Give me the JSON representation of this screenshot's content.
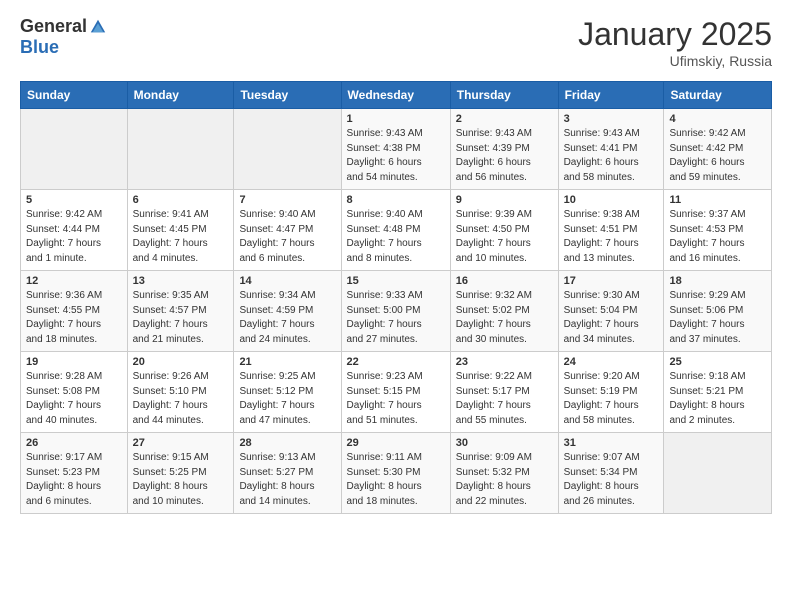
{
  "header": {
    "logo_general": "General",
    "logo_blue": "Blue",
    "month_title": "January 2025",
    "location": "Ufimskiy, Russia"
  },
  "weekdays": [
    "Sunday",
    "Monday",
    "Tuesday",
    "Wednesday",
    "Thursday",
    "Friday",
    "Saturday"
  ],
  "weeks": [
    [
      {
        "day": "",
        "info": ""
      },
      {
        "day": "",
        "info": ""
      },
      {
        "day": "",
        "info": ""
      },
      {
        "day": "1",
        "info": "Sunrise: 9:43 AM\nSunset: 4:38 PM\nDaylight: 6 hours\nand 54 minutes."
      },
      {
        "day": "2",
        "info": "Sunrise: 9:43 AM\nSunset: 4:39 PM\nDaylight: 6 hours\nand 56 minutes."
      },
      {
        "day": "3",
        "info": "Sunrise: 9:43 AM\nSunset: 4:41 PM\nDaylight: 6 hours\nand 58 minutes."
      },
      {
        "day": "4",
        "info": "Sunrise: 9:42 AM\nSunset: 4:42 PM\nDaylight: 6 hours\nand 59 minutes."
      }
    ],
    [
      {
        "day": "5",
        "info": "Sunrise: 9:42 AM\nSunset: 4:44 PM\nDaylight: 7 hours\nand 1 minute."
      },
      {
        "day": "6",
        "info": "Sunrise: 9:41 AM\nSunset: 4:45 PM\nDaylight: 7 hours\nand 4 minutes."
      },
      {
        "day": "7",
        "info": "Sunrise: 9:40 AM\nSunset: 4:47 PM\nDaylight: 7 hours\nand 6 minutes."
      },
      {
        "day": "8",
        "info": "Sunrise: 9:40 AM\nSunset: 4:48 PM\nDaylight: 7 hours\nand 8 minutes."
      },
      {
        "day": "9",
        "info": "Sunrise: 9:39 AM\nSunset: 4:50 PM\nDaylight: 7 hours\nand 10 minutes."
      },
      {
        "day": "10",
        "info": "Sunrise: 9:38 AM\nSunset: 4:51 PM\nDaylight: 7 hours\nand 13 minutes."
      },
      {
        "day": "11",
        "info": "Sunrise: 9:37 AM\nSunset: 4:53 PM\nDaylight: 7 hours\nand 16 minutes."
      }
    ],
    [
      {
        "day": "12",
        "info": "Sunrise: 9:36 AM\nSunset: 4:55 PM\nDaylight: 7 hours\nand 18 minutes."
      },
      {
        "day": "13",
        "info": "Sunrise: 9:35 AM\nSunset: 4:57 PM\nDaylight: 7 hours\nand 21 minutes."
      },
      {
        "day": "14",
        "info": "Sunrise: 9:34 AM\nSunset: 4:59 PM\nDaylight: 7 hours\nand 24 minutes."
      },
      {
        "day": "15",
        "info": "Sunrise: 9:33 AM\nSunset: 5:00 PM\nDaylight: 7 hours\nand 27 minutes."
      },
      {
        "day": "16",
        "info": "Sunrise: 9:32 AM\nSunset: 5:02 PM\nDaylight: 7 hours\nand 30 minutes."
      },
      {
        "day": "17",
        "info": "Sunrise: 9:30 AM\nSunset: 5:04 PM\nDaylight: 7 hours\nand 34 minutes."
      },
      {
        "day": "18",
        "info": "Sunrise: 9:29 AM\nSunset: 5:06 PM\nDaylight: 7 hours\nand 37 minutes."
      }
    ],
    [
      {
        "day": "19",
        "info": "Sunrise: 9:28 AM\nSunset: 5:08 PM\nDaylight: 7 hours\nand 40 minutes."
      },
      {
        "day": "20",
        "info": "Sunrise: 9:26 AM\nSunset: 5:10 PM\nDaylight: 7 hours\nand 44 minutes."
      },
      {
        "day": "21",
        "info": "Sunrise: 9:25 AM\nSunset: 5:12 PM\nDaylight: 7 hours\nand 47 minutes."
      },
      {
        "day": "22",
        "info": "Sunrise: 9:23 AM\nSunset: 5:15 PM\nDaylight: 7 hours\nand 51 minutes."
      },
      {
        "day": "23",
        "info": "Sunrise: 9:22 AM\nSunset: 5:17 PM\nDaylight: 7 hours\nand 55 minutes."
      },
      {
        "day": "24",
        "info": "Sunrise: 9:20 AM\nSunset: 5:19 PM\nDaylight: 7 hours\nand 58 minutes."
      },
      {
        "day": "25",
        "info": "Sunrise: 9:18 AM\nSunset: 5:21 PM\nDaylight: 8 hours\nand 2 minutes."
      }
    ],
    [
      {
        "day": "26",
        "info": "Sunrise: 9:17 AM\nSunset: 5:23 PM\nDaylight: 8 hours\nand 6 minutes."
      },
      {
        "day": "27",
        "info": "Sunrise: 9:15 AM\nSunset: 5:25 PM\nDaylight: 8 hours\nand 10 minutes."
      },
      {
        "day": "28",
        "info": "Sunrise: 9:13 AM\nSunset: 5:27 PM\nDaylight: 8 hours\nand 14 minutes."
      },
      {
        "day": "29",
        "info": "Sunrise: 9:11 AM\nSunset: 5:30 PM\nDaylight: 8 hours\nand 18 minutes."
      },
      {
        "day": "30",
        "info": "Sunrise: 9:09 AM\nSunset: 5:32 PM\nDaylight: 8 hours\nand 22 minutes."
      },
      {
        "day": "31",
        "info": "Sunrise: 9:07 AM\nSunset: 5:34 PM\nDaylight: 8 hours\nand 26 minutes."
      },
      {
        "day": "",
        "info": ""
      }
    ]
  ]
}
